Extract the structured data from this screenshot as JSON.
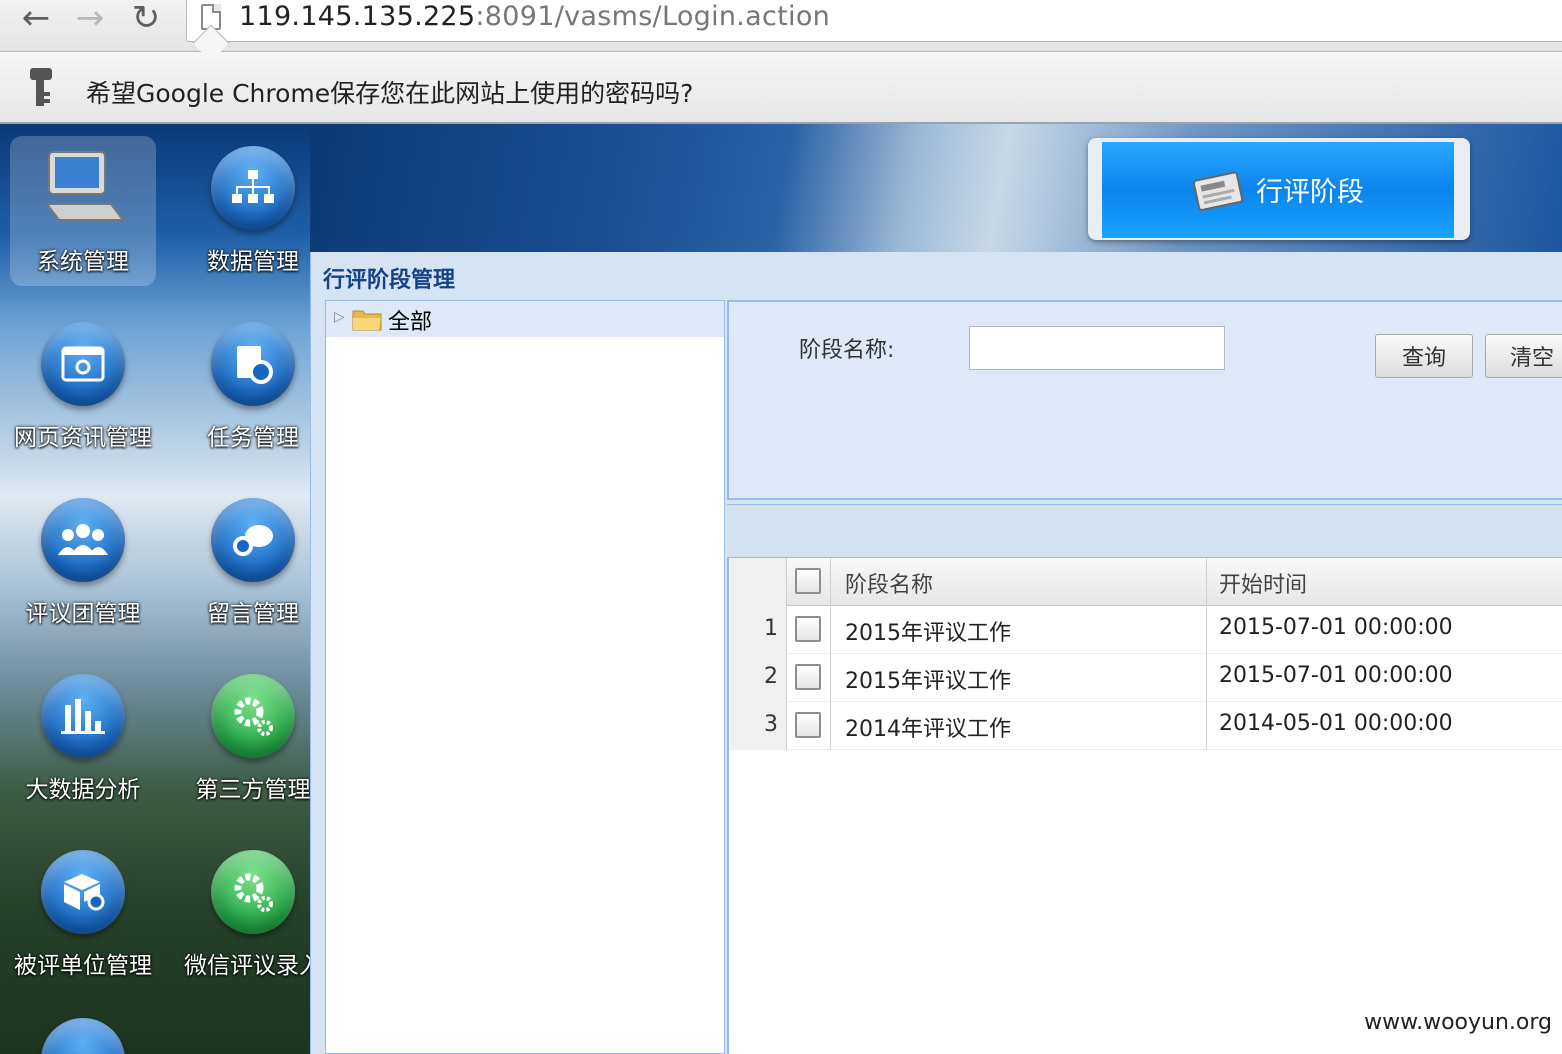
{
  "browser": {
    "url_host": "119.145.135.225",
    "url_rest": ":8091/vasms/Login.action",
    "password_prompt": "希望Google Chrome保存您在此网站上使用的密码吗?"
  },
  "desktop": {
    "items": [
      {
        "label": "系统管理",
        "icon": "computer-icon"
      },
      {
        "label": "数据管理",
        "icon": "sitemap-icon"
      },
      {
        "label": "网页资讯管理",
        "icon": "web-settings-icon"
      },
      {
        "label": "任务管理",
        "icon": "task-settings-icon"
      },
      {
        "label": "评议团管理",
        "icon": "group-icon"
      },
      {
        "label": "留言管理",
        "icon": "message-icon"
      },
      {
        "label": "大数据分析",
        "icon": "bar-chart-icon"
      },
      {
        "label": "第三方管理",
        "icon": "gears-icon"
      },
      {
        "label": "被评单位管理",
        "icon": "box-settings-icon"
      },
      {
        "label": "微信评议录入",
        "icon": "gears-icon"
      }
    ]
  },
  "banner": {
    "title": "行评阶段"
  },
  "window": {
    "title": "行评阶段管理",
    "tree": {
      "root_label": "全部"
    },
    "search": {
      "name_label": "阶段名称:",
      "name_value": "",
      "query_button": "查询",
      "clear_button": "清空"
    },
    "grid": {
      "columns": [
        "阶段名称",
        "开始时间"
      ],
      "rows": [
        {
          "num": "1",
          "name": "2015年评议工作",
          "start": "2015-07-01 00:00:00"
        },
        {
          "num": "2",
          "name": "2015年评议工作",
          "start": "2015-07-01 00:00:00"
        },
        {
          "num": "3",
          "name": "2014年评议工作",
          "start": "2014-05-01 00:00:00"
        }
      ]
    }
  },
  "watermark": "www.wooyun.org"
}
